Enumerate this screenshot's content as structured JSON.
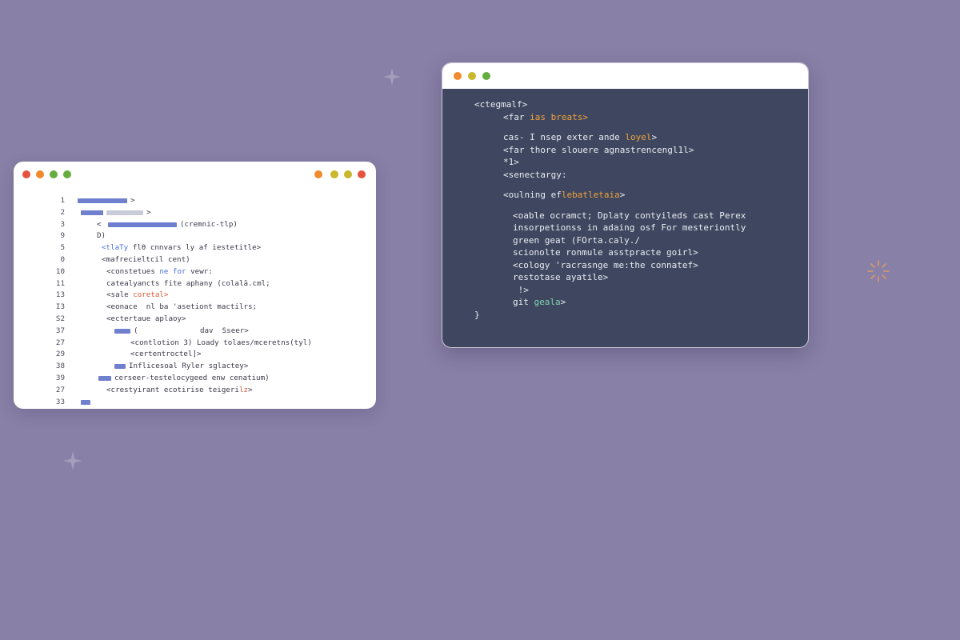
{
  "colors": {
    "background": "#8880a6",
    "dot_red": "#e5533f",
    "dot_orange": "#f08a2c",
    "dot_yellow": "#c9b72c",
    "dot_green": "#66ad3f",
    "bar_blue": "#6f80cf",
    "bar_gray": "#c9cbd8",
    "keyword_blue": "#4a73d8",
    "accent_red": "#d9573a",
    "accent_orange": "#f0a23a",
    "accent_teal": "#7fd3b0"
  },
  "light_editor": {
    "titlebar": {
      "left_dots": [
        "dot_red",
        "dot_orange",
        "dot_green",
        "dot_green"
      ],
      "right_icons": [
        "settings-badge-icon",
        "dot_yellow",
        "dot_yellow",
        "dot_red"
      ]
    },
    "lines": [
      {
        "num": "1",
        "bars": [
          {
            "color": "bar_blue",
            "w": 62
          }
        ],
        "text": ">"
      },
      {
        "num": "2",
        "bars": [
          {
            "color": "bar_blue",
            "w": 28
          },
          {
            "color": "bar_gray",
            "w": 46
          }
        ],
        "text": ">"
      },
      {
        "num": "3",
        "prefix": "<",
        "bars": [
          {
            "color": "bar_blue",
            "w": 86
          }
        ],
        "text": "(cremnic-tlp)"
      },
      {
        "num": "9",
        "text": "D)"
      },
      {
        "num": "5",
        "text": "<tlaTy",
        "text2": " flθ cnnvars ly af iestetitle>"
      },
      {
        "num": "0",
        "text": "<mafrecieltcil cent)"
      },
      {
        "num": "10",
        "text": "<constetues",
        "text2": " ne for",
        "text3": " vewr:"
      },
      {
        "num": "11",
        "text": "catealyancts fite aphany (colalā.cml;"
      },
      {
        "num": "13",
        "text": "<sale",
        "text2": " coretal>"
      },
      {
        "num": "I3",
        "text": "<eonace  nl ba 'asetiont mactilrs;"
      },
      {
        "num": "S2",
        "text": "<ectertaue aplaoy>"
      },
      {
        "num": "37",
        "bars": [
          {
            "color": "bar_blue",
            "w": 20
          }
        ],
        "text": "(",
        "text2": "              dav  Sseer>"
      },
      {
        "num": "27",
        "text": "<contlotion 3) Loady tolaes/mceretns(tyl)"
      },
      {
        "num": "29",
        "text": "<certentroctel]>"
      },
      {
        "num": "38",
        "bars": [
          {
            "color": "bar_blue",
            "w": 14
          }
        ],
        "text": "Inflicesoal Ryler sglactey>"
      },
      {
        "num": "39",
        "bars": [
          {
            "color": "bar_blue",
            "w": 16
          }
        ],
        "text": "cerseer-testeloc",
        "text2": "ygeed",
        "text3": " enw cenatium)"
      },
      {
        "num": "27",
        "text": "<crestyirant ecotirise teigeri",
        "text2": "lz",
        "text3": ">"
      },
      {
        "num": "33",
        "bars": [
          {
            "color": "bar_blue",
            "w": 12
          }
        ],
        "text": ""
      }
    ]
  },
  "dark_editor": {
    "titlebar": {
      "dots": [
        "dot_orange",
        "dot_yellow",
        "dot_green"
      ]
    },
    "lines": [
      {
        "indent": 0,
        "parts": [
          {
            "t": "<ctegmalf>"
          }
        ]
      },
      {
        "indent": 3,
        "parts": [
          {
            "t": "<far "
          },
          {
            "t": "ias breats>",
            "c": "accent_orange"
          }
        ]
      },
      {
        "gap": true
      },
      {
        "indent": 3,
        "parts": [
          {
            "t": "cas- I nsep exter ande "
          },
          {
            "t": "loyel",
            "c": "accent_orange"
          },
          {
            "t": ">"
          }
        ]
      },
      {
        "indent": 3,
        "parts": [
          {
            "t": "<far thore slouere agnastrencengl1l>"
          }
        ]
      },
      {
        "indent": 3,
        "parts": [
          {
            "t": "*1>"
          }
        ]
      },
      {
        "indent": 3,
        "parts": [
          {
            "t": "<senectargy:"
          }
        ]
      },
      {
        "gap": true
      },
      {
        "indent": 3,
        "parts": [
          {
            "t": "<oulning "
          },
          {
            "t": "ef"
          },
          {
            "t": "lebatletaia",
            "c": "accent_orange"
          },
          {
            "t": ">"
          }
        ]
      },
      {
        "gap": true
      },
      {
        "indent": 4,
        "parts": [
          {
            "t": "<oable ocramct; Dplaty contyileds cast Perex"
          }
        ]
      },
      {
        "indent": 4,
        "parts": [
          {
            "t": "insorpetionss in adaing osf For mesteriontly"
          }
        ]
      },
      {
        "indent": 4,
        "parts": [
          {
            "t": "green geat (FOrta.caly./"
          }
        ]
      },
      {
        "indent": 4,
        "parts": [
          {
            "t": "scionolte ronmule asstpracte goirl>"
          }
        ]
      },
      {
        "indent": 4,
        "parts": [
          {
            "t": "<cology 'racrasnge me:the connatef>"
          }
        ]
      },
      {
        "indent": 4,
        "parts": [
          {
            "t": "restotase ayatile>"
          }
        ]
      },
      {
        "indent": 4,
        "parts": [
          {
            "t": " !>"
          }
        ]
      },
      {
        "indent": 4,
        "parts": [
          {
            "t": "git "
          },
          {
            "t": "geala",
            "c": "accent_teal"
          },
          {
            "t": ">"
          }
        ]
      },
      {
        "indent": 0,
        "parts": [
          {
            "t": "}"
          }
        ]
      }
    ]
  }
}
